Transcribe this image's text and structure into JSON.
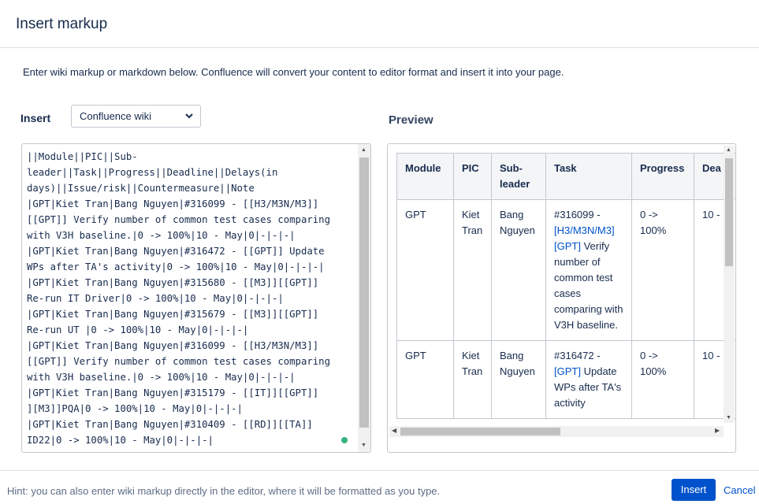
{
  "dialog": {
    "title": "Insert markup"
  },
  "intro": "Enter wiki markup or markdown below. Confluence will convert your content to editor format and insert it into your page.",
  "insert_panel": {
    "label": "Insert",
    "format_selected": "Confluence wiki",
    "editor_lines": [
      "||Module||PIC||Sub-",
      "leader||Task||Progress||Deadline||Delays(in",
      "days)||Issue/risk||Countermeasure||Note",
      "|GPT|Kiet Tran|Bang Nguyen|#316099 - [[H3/M3N/M3]]",
      "[[GPT]] Verify number of common test cases comparing",
      "with V3H baseline.|0 -> 100%|10 - May|0|-|-|-|",
      "|GPT|Kiet Tran|Bang Nguyen|#316472 - [[GPT]] Update",
      "WPs after TA's activity|0 -> 100%|10 - May|0|-|-|-|",
      "|GPT|Kiet Tran|Bang Nguyen|#315680 - [[M3]][[GPT]]",
      "Re-run IT Driver|0 -> 100%|10 - May|0|-|-|-|",
      "|GPT|Kiet Tran|Bang Nguyen|#315679 - [[M3]][[GPT]]",
      "Re-run UT |0 -> 100%|10 - May|0|-|-|-|",
      "|GPT|Kiet Tran|Bang Nguyen|#316099 - [[H3/M3N/M3]]",
      "[[GPT]] Verify number of common test cases comparing",
      "with V3H baseline.|0 -> 100%|10 - May|0|-|-|-|",
      "|GPT|Kiet Tran|Bang Nguyen|#315179 - [[IT]][[GPT]]",
      "][M3]]PQA|0 -> 100%|10 - May|0|-|-|-|",
      "|GPT|Kiet Tran|Bang Nguyen|#310409 - [[RD]][[TA]]",
      "ID22|0 -> 100%|10 - May|0|-|-|-|"
    ]
  },
  "preview_panel": {
    "label": "Preview",
    "headers": [
      "Module",
      "PIC",
      "Sub-leader",
      "Task",
      "Progress",
      "Dea"
    ],
    "rows": [
      {
        "module": "GPT",
        "pic": "Kiet Tran",
        "subleader": "Bang Nguyen",
        "task_prefix": "#316099 - ",
        "task_link1": "H3/M3N/M3",
        "task_link2": "GPT",
        "task_suffix": " Verify number of common test cases comparing with V3H baseline.",
        "progress": "0 -> 100%",
        "deadline": "10 -"
      },
      {
        "module": "GPT",
        "pic": "Kiet Tran",
        "subleader": "Bang Nguyen",
        "task_prefix": "#316472 - ",
        "task_link1": "",
        "task_link2": "GPT",
        "task_suffix": " Update WPs after TA's activity",
        "progress": "0 -> 100%",
        "deadline": "10 -"
      }
    ]
  },
  "footer": {
    "hint": "Hint: you can also enter wiki markup directly in the editor, where it will be formatted as you type.",
    "insert_label": "Insert",
    "cancel_label": "Cancel"
  },
  "colors": {
    "primary": "#0052cc",
    "link": "#0052cc",
    "status_dot": "#36b37e"
  }
}
